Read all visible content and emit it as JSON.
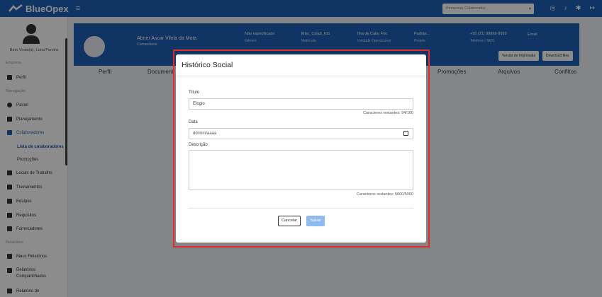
{
  "app": {
    "name": "BlueOpex"
  },
  "topbar": {
    "search_placeholder": "Pesquisar Colaborador"
  },
  "sidebar": {
    "user_name": "Bem Vindo(a), Luna Pereira",
    "sections": {
      "empresa": "Empresa",
      "navegacao": "Navegação",
      "relatorios": "Relatórios"
    },
    "items": {
      "perfil": "Perfil",
      "painel": "Painel",
      "planejamento": "Planejamento",
      "colaboradores": "Colaboradores",
      "lista_colaboradores": "Lista de colaboradores",
      "promocoes": "Promoções",
      "locais": "Locais de Trabalho",
      "treinamentos": "Treinamentos",
      "equipes": "Equipes",
      "requisitos": "Requisitos",
      "fornecedores": "Fornecedores",
      "meus_relatorios": "Meus Relatórios",
      "relatorios_compartilhados": "Relatórios Compartilhados",
      "relatorio_de": "Relatório de"
    }
  },
  "banner": {
    "name": "Abner Ascar Vilela da Mota",
    "role": "Comandante",
    "fields": [
      {
        "value": "Não especificado",
        "label": "Gênero"
      },
      {
        "value": "Misc_Colab_011",
        "label": "Matrícula"
      },
      {
        "value": "Ilha de Cabo Frio",
        "label": "Unidade Operacional"
      },
      {
        "value": "Padrão...",
        "label": "Projeto"
      },
      {
        "value": "+55 (21) 99999-9999",
        "label": "Telefone / SMS"
      },
      {
        "value": "Email",
        "label": ""
      }
    ],
    "print_button": "Versão de Impressão",
    "download_button": "Download files"
  },
  "tabs": [
    "Perfil",
    "Document",
    "Promoções",
    "Arquivos",
    "Conflitos"
  ],
  "modal": {
    "title": "Histórico Social",
    "titulo_label": "Título",
    "titulo_value": "Elogio",
    "titulo_counter": "Caracteres restantes: 94/100",
    "data_label": "Data",
    "data_placeholder": "dd/mm/aaaa",
    "descricao_label": "Descrição",
    "descricao_value": "",
    "descricao_counter": "Caracteres restantes: 5000/5000",
    "cancel_button": "Cancelar",
    "save_button": "Salvar"
  }
}
